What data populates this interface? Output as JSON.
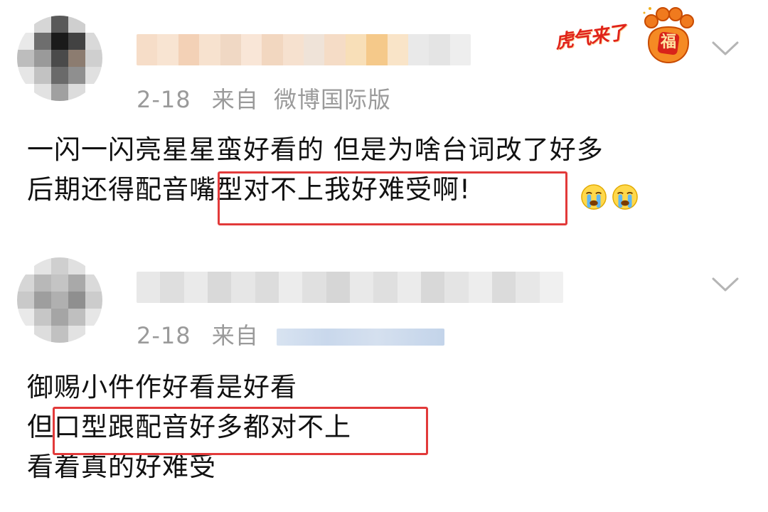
{
  "posts": [
    {
      "date": "2-18",
      "source_prefix": "来自",
      "source_name": "微博国际版",
      "lines": [
        "一闪一闪亮星星蛮好看的 但是为啥台词改了好多",
        "后期还得配音嘴型对不上我好难受啊!"
      ],
      "emoji": [
        "crying-face-icon",
        "crying-face-icon"
      ]
    },
    {
      "date": "2-18",
      "source_prefix": "来自",
      "lines": [
        "御赐小件作好看是好看",
        "但口型跟配音好多都对不上",
        "看着真的好难受"
      ]
    }
  ],
  "badge": {
    "text": "虎气来了",
    "fu": "福"
  },
  "colors": {
    "highlight": "#e23a3a",
    "meta": "#9a9a9a",
    "text": "#111111"
  }
}
